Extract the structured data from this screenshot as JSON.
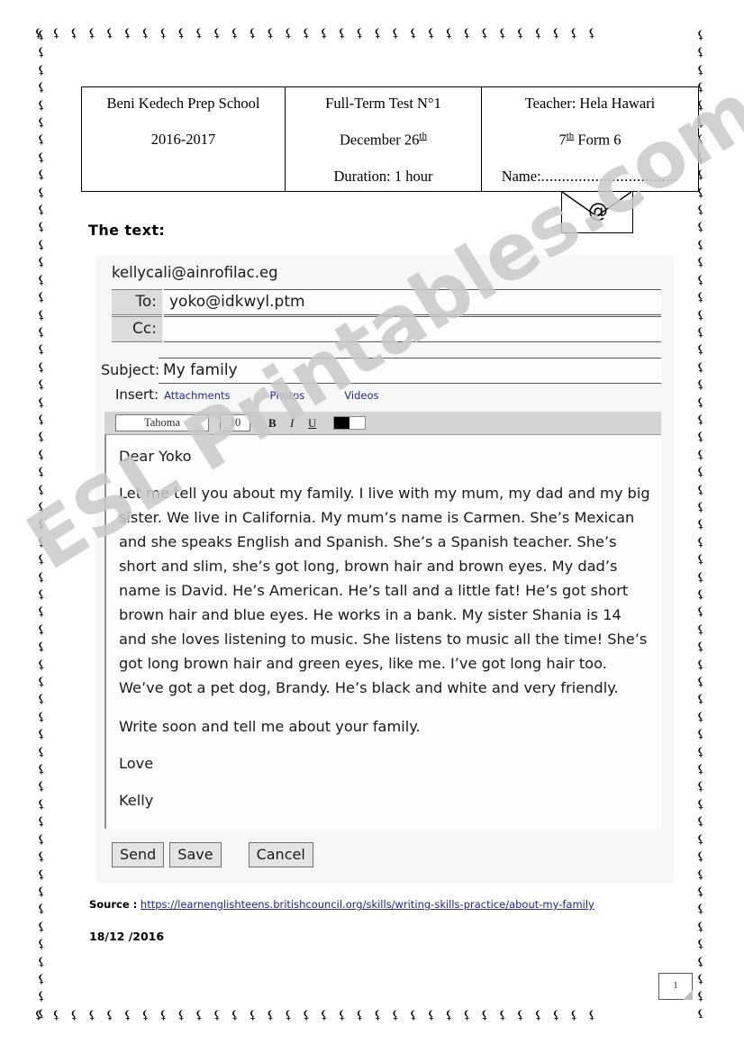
{
  "document": {
    "section_label": "The text:",
    "envelope_icon_glyph": "@",
    "page_number": "1",
    "date_stamp": "18/12 /2016"
  },
  "header_table": {
    "columns": [
      {
        "name": "school",
        "lines": [
          "Beni Kedech Prep School",
          "2016-2017",
          ""
        ]
      },
      {
        "name": "test",
        "lines": [
          "Full-Term Test N°1",
          "December 26",
          "Duration: 1 hour"
        ],
        "ordinal_suffix": "th"
      },
      {
        "name": "teacher",
        "lines": [
          "Teacher: Hela Hawari",
          "Form 6",
          "Name:"
        ],
        "form_prefix": "7",
        "ordinal_suffix": "th",
        "name_dots": "................................."
      }
    ]
  },
  "email": {
    "from_address": "kellycali@ainrofilac.eg",
    "fields": [
      {
        "label": "To:",
        "value": "yoko@idkwyl.ptm"
      },
      {
        "label": "Cc:",
        "value": ""
      }
    ],
    "subject": {
      "label": "Subject:",
      "value": "My family"
    },
    "insert": {
      "label": "Insert:",
      "links": [
        "Attachments",
        "Photos",
        "Videos"
      ]
    },
    "toolbar": {
      "font_family": "Tahoma",
      "font_size": "10",
      "bold": "B",
      "italic": "I",
      "underline": "U",
      "color_swatch_hex": "#000000"
    },
    "body": {
      "greeting": "Dear Yoko",
      "paragraph_1": "Let me tell you about my family. I live with my mum, my dad and my big sister. We live in California. My mum’s name is Carmen. She’s Mexican and she speaks English and Spanish. She’s a Spanish teacher. She’s short and slim, she’s got long, brown hair and brown eyes. My dad’s name is David. He’s American. He’s tall and a little fat! He’s got short brown hair and blue eyes. He works in a bank. My sister Shania is 14 and she loves listening to music. She listens to music all the time! She’s got long brown hair and green eyes, like me. I’ve got long hair too. We’ve got a pet dog, Brandy. He’s black and white and very friendly.",
      "paragraph_2": "Write soon and tell me about your family.",
      "signoff": "Love",
      "signature": "Kelly"
    },
    "actions": [
      {
        "name": "send",
        "label": "Send"
      },
      {
        "name": "save",
        "label": "Save"
      },
      {
        "name": "cancel",
        "label": "Cancel"
      }
    ]
  },
  "source": {
    "label": "Source :",
    "url_text": "https://learnenglishteens.britishcouncil.org/skills/writing-skills-practice/about-my-family"
  },
  "watermark": {
    "text": "ESL Printables.com",
    "color": "#c9c9c9"
  },
  "decor": {
    "border_glyph": "⚸"
  }
}
